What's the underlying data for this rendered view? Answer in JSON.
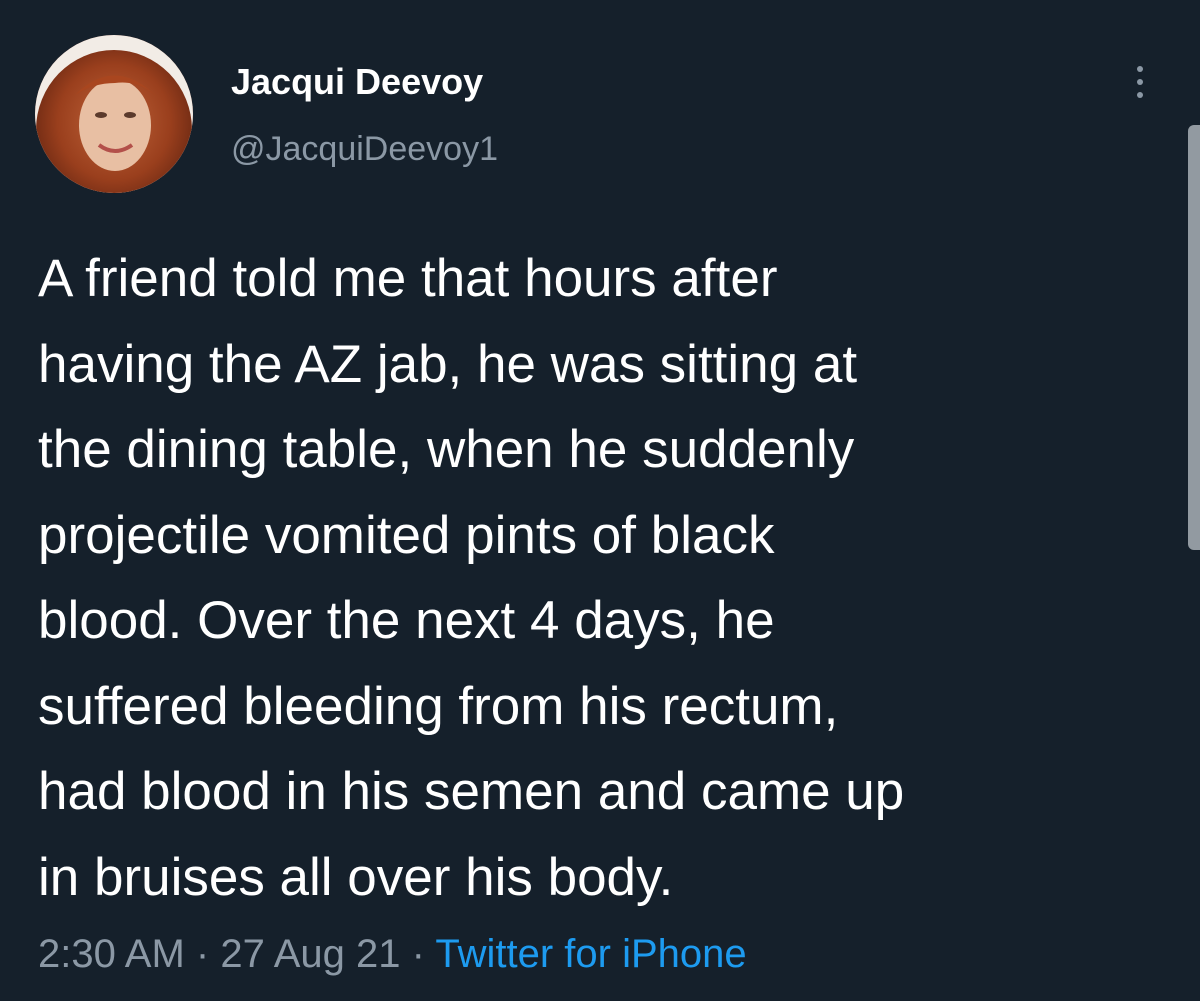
{
  "user": {
    "display_name": "Jacqui Deevoy",
    "handle": "@JacquiDeevoy1"
  },
  "tweet": {
    "text": "A friend told me that hours after\nhaving the AZ jab, he was sitting at\nthe dining table, when he suddenly\nprojectile vomited pints of black\nblood. Over the next 4 days, he\nsuffered bleeding from his rectum,\nhad blood in his semen and came up\nin bruises all over his body.",
    "time": "2:30 AM",
    "separator": "·",
    "date": "27 Aug 21",
    "source": "Twitter for iPhone"
  },
  "icons": {
    "more": "more-vertical-icon"
  },
  "colors": {
    "background": "#15202b",
    "primary_text": "#ffffff",
    "secondary_text": "#8b98a5",
    "accent": "#1d9bf0"
  }
}
